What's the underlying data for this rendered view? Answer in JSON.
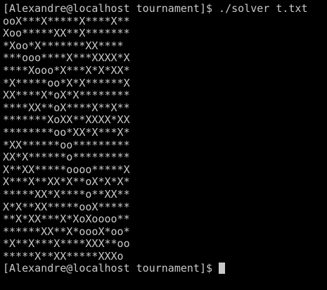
{
  "terminal": {
    "prompt": "[Alexandre@localhost tournament]$ ",
    "command": "./solver t.txt",
    "output": [
      "ooX***X*****X****X**",
      "Xoo*****XX**X*******",
      "*Xoo*X*******XX****",
      "***ooo****X***XXXX*X",
      "****Xooo*X***X*X*XX*",
      "*X*****oo*X*X******X",
      "XX****X*oX*X********",
      "****XX**oX****X**X**",
      "*******XoXX**XXXX*XX",
      "********oo*XX*X***X*",
      "*XX******oo*********",
      "XX*X******o*********",
      "X**XX*****oooo*****X",
      "X***X**XX*X**oX*X*X*",
      "*****XX*X****o**XX**",
      "X*X**XX*****ooX*****",
      "**X*XX***X*XoXoooo**",
      "******XX**X*oooX*oo*",
      "*X**X***X****XXX**oo",
      "*****X**XX*****XXXo"
    ],
    "final_prompt": "[Alexandre@localhost tournament]$ ",
    "colors": {
      "background": "#000000",
      "text": "#c9c9c9"
    }
  }
}
